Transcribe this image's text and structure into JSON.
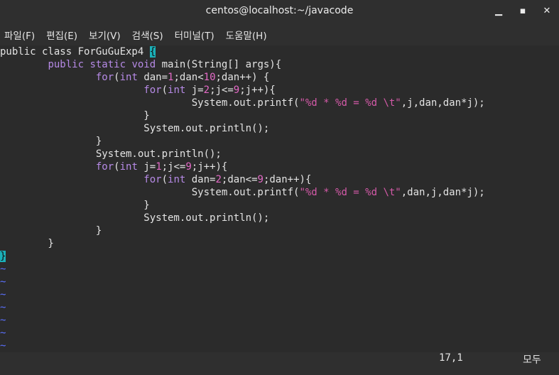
{
  "window": {
    "title": "centos@localhost:~/javacode",
    "minimize_glyph": "▁",
    "maximize_glyph": "▪",
    "close_glyph": "✕"
  },
  "menu": {
    "items": [
      "파일(F)",
      "편집(E)",
      "보기(V)",
      "검색(S)",
      "터미널(T)",
      "도움말(H)"
    ]
  },
  "code": {
    "lines": [
      [
        [
          "public class ForGuGuExp4 ",
          ""
        ],
        [
          "{",
          "bracket"
        ]
      ],
      [
        [
          "        ",
          ""
        ],
        [
          "public static void ",
          "kw"
        ],
        [
          "main(String[] args){",
          ""
        ]
      ],
      [
        [
          "                ",
          ""
        ],
        [
          "for",
          "kw"
        ],
        [
          "(",
          ""
        ],
        [
          "int",
          "kw"
        ],
        [
          " dan=",
          ""
        ],
        [
          "1",
          "num"
        ],
        [
          ";dan<",
          ""
        ],
        [
          "10",
          "num"
        ],
        [
          ";dan++) {",
          ""
        ]
      ],
      [
        [
          "                        ",
          ""
        ],
        [
          "for",
          "kw"
        ],
        [
          "(",
          ""
        ],
        [
          "int",
          "kw"
        ],
        [
          " j=",
          ""
        ],
        [
          "2",
          "num"
        ],
        [
          ";j<=",
          ""
        ],
        [
          "9",
          "num"
        ],
        [
          ";j++){",
          ""
        ]
      ],
      [
        [
          "                                System.out.printf(",
          ""
        ],
        [
          "\"%d * %d = %d \\t\"",
          "str"
        ],
        [
          ",j,dan,dan*j);",
          ""
        ]
      ],
      [
        [
          "                        }",
          ""
        ]
      ],
      [
        [
          "                        System.out.println();",
          ""
        ]
      ],
      [
        [
          "                }",
          ""
        ]
      ],
      [
        [
          "                System.out.println();",
          ""
        ]
      ],
      [
        [
          "                ",
          ""
        ],
        [
          "for",
          "kw"
        ],
        [
          "(",
          ""
        ],
        [
          "int",
          "kw"
        ],
        [
          " j=",
          ""
        ],
        [
          "1",
          "num"
        ],
        [
          ";j<=",
          ""
        ],
        [
          "9",
          "num"
        ],
        [
          ";j++){",
          ""
        ]
      ],
      [
        [
          "                        ",
          ""
        ],
        [
          "for",
          "kw"
        ],
        [
          "(",
          ""
        ],
        [
          "int",
          "kw"
        ],
        [
          " dan=",
          ""
        ],
        [
          "2",
          "num"
        ],
        [
          ";dan<=",
          ""
        ],
        [
          "9",
          "num"
        ],
        [
          ";dan++){",
          ""
        ]
      ],
      [
        [
          "                                System.out.printf(",
          ""
        ],
        [
          "\"%d * %d = %d \\t\"",
          "str"
        ],
        [
          ",dan,j,dan*j);",
          ""
        ]
      ],
      [
        [
          "                        }",
          ""
        ]
      ],
      [
        [
          "                        System.out.println();",
          ""
        ]
      ],
      [
        [
          "                }",
          ""
        ]
      ],
      [
        [
          "        }",
          ""
        ]
      ],
      [
        [
          "}",
          "bracket"
        ]
      ],
      [
        [
          "~",
          "tilde"
        ]
      ],
      [
        [
          "~",
          "tilde"
        ]
      ],
      [
        [
          "~",
          "tilde"
        ]
      ],
      [
        [
          "~",
          "tilde"
        ]
      ],
      [
        [
          "~",
          "tilde"
        ]
      ],
      [
        [
          "~",
          "tilde"
        ]
      ],
      [
        [
          "~",
          "tilde"
        ]
      ]
    ]
  },
  "status": {
    "position": "17,1",
    "mode": "모두"
  }
}
